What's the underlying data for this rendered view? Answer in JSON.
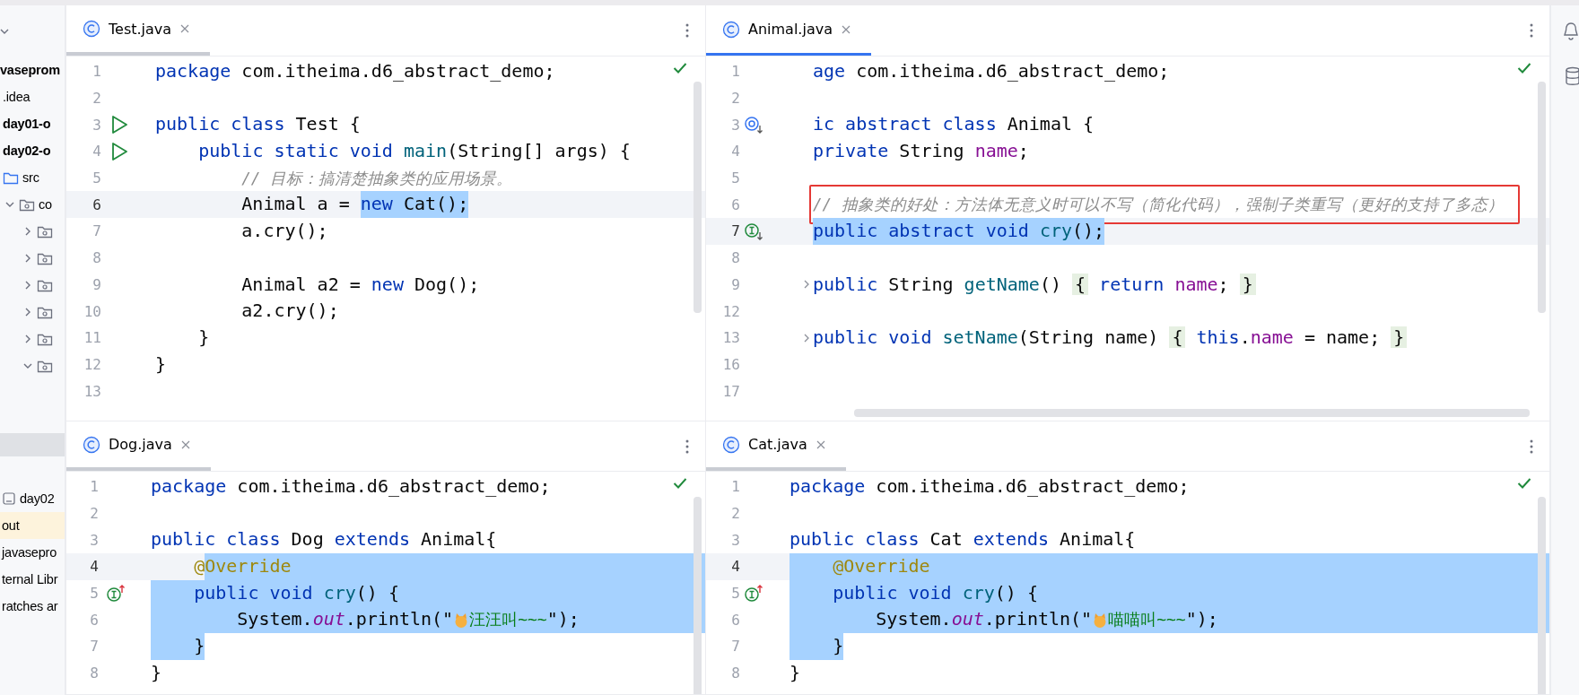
{
  "sidebar": {
    "tree": [
      {
        "label": "vaseprom",
        "bold": true,
        "children": [
          {
            "label": ".idea",
            "bold": false
          },
          {
            "label": "day01-o",
            "bold": true
          },
          {
            "label": "day02-o",
            "bold": true
          },
          {
            "label": "src",
            "bold": false,
            "kind": "folder",
            "children": [
              {
                "label": "co",
                "bold": false,
                "kind": "package",
                "expanded": true,
                "children": [
                  {
                    "kind": "package",
                    "expanded": false
                  },
                  {
                    "kind": "package",
                    "expanded": false
                  },
                  {
                    "kind": "package",
                    "expanded": false
                  },
                  {
                    "kind": "package",
                    "expanded": false
                  },
                  {
                    "kind": "package",
                    "expanded": false
                  },
                  {
                    "kind": "package",
                    "expanded": true
                  }
                ]
              }
            ]
          }
        ]
      }
    ],
    "lower": [
      {
        "label": "day02",
        "kind": "module",
        "highlighted": false
      },
      {
        "label": "out",
        "highlighted": true
      },
      {
        "label": "javasepro",
        "highlighted": false
      },
      {
        "label": "ternal Libr",
        "highlighted": false
      },
      {
        "label": "ratches ar",
        "highlighted": false
      }
    ]
  },
  "panes": [
    {
      "tabs": [
        {
          "label": "Test.java",
          "selected": false
        }
      ],
      "h_scroll": false,
      "lines": [
        {
          "num": "1",
          "current": false,
          "folded": false,
          "boxed": false,
          "eol_selected": false,
          "tokens": [
            {
              "t": "package",
              "kind": "kw",
              "selected": false
            },
            {
              "t": " com.itheima.d6_abstract_demo;",
              "kind": "pl",
              "selected": false
            }
          ]
        },
        {
          "num": "2",
          "current": false,
          "folded": false,
          "boxed": false,
          "eol_selected": false
        },
        {
          "num": "3",
          "gutter": {
            "kind": "run"
          },
          "current": false,
          "folded": false,
          "boxed": false,
          "eol_selected": false,
          "tokens": [
            {
              "t": "public class",
              "kind": "kw",
              "selected": false
            },
            {
              "t": " Test {",
              "kind": "pl",
              "selected": false
            }
          ]
        },
        {
          "num": "4",
          "gutter": {
            "kind": "run"
          },
          "current": false,
          "folded": false,
          "boxed": false,
          "eol_selected": false,
          "tokens": [
            {
              "t": "    public static void",
              "kind": "kw",
              "selected": false
            },
            {
              "t": " main",
              "kind": "fn",
              "selected": false
            },
            {
              "t": "(String[] args) {",
              "kind": "pl",
              "selected": false
            }
          ]
        },
        {
          "num": "5",
          "current": false,
          "folded": false,
          "boxed": false,
          "eol_selected": false,
          "tokens": [
            {
              "t": "        // 目标：搞清楚抽象类的应用场景。",
              "kind": "cm",
              "selected": false
            }
          ]
        },
        {
          "num": "6",
          "current": true,
          "folded": false,
          "boxed": false,
          "eol_selected": false,
          "tokens": [
            {
              "t": "        Animal a = ",
              "kind": "pl",
              "selected": false
            },
            {
              "t": "new",
              "kind": "kw",
              "selected": true
            },
            {
              "t": " Cat();",
              "kind": "pl",
              "selected": true
            }
          ]
        },
        {
          "num": "7",
          "current": false,
          "folded": false,
          "boxed": false,
          "eol_selected": false,
          "tokens": [
            {
              "t": "        a.cry();",
              "kind": "pl",
              "selected": false
            }
          ]
        },
        {
          "num": "8",
          "current": false,
          "folded": false,
          "boxed": false,
          "eol_selected": false
        },
        {
          "num": "9",
          "current": false,
          "folded": false,
          "boxed": false,
          "eol_selected": false,
          "tokens": [
            {
              "t": "        Animal a2 = ",
              "kind": "pl",
              "selected": false
            },
            {
              "t": "new",
              "kind": "kw",
              "selected": false
            },
            {
              "t": " Dog();",
              "kind": "pl",
              "selected": false
            }
          ]
        },
        {
          "num": "10",
          "current": false,
          "folded": false,
          "boxed": false,
          "eol_selected": false,
          "tokens": [
            {
              "t": "        a2.cry();",
              "kind": "pl",
              "selected": false
            }
          ]
        },
        {
          "num": "11",
          "current": false,
          "folded": false,
          "boxed": false,
          "eol_selected": false,
          "tokens": [
            {
              "t": "    }",
              "kind": "pl",
              "selected": false
            }
          ]
        },
        {
          "num": "12",
          "current": false,
          "folded": false,
          "boxed": false,
          "eol_selected": false,
          "tokens": [
            {
              "t": "}",
              "kind": "pl",
              "selected": false
            }
          ]
        },
        {
          "num": "13",
          "current": false,
          "folded": false,
          "boxed": false,
          "eol_selected": false
        }
      ]
    },
    {
      "tabs": [
        {
          "label": "Animal.java",
          "selected": true
        }
      ],
      "h_scroll": true,
      "lines": [
        {
          "num": "1",
          "current": false,
          "folded": false,
          "boxed": false,
          "eol_selected": false,
          "tokens": [
            {
              "t": "age",
              "kind": "kw",
              "selected": false
            },
            {
              "t": " com.itheima.d6_abstract_demo;",
              "kind": "pl",
              "selected": false
            }
          ]
        },
        {
          "num": "2",
          "current": false,
          "folded": false,
          "boxed": false,
          "eol_selected": false
        },
        {
          "num": "3",
          "gutter": {
            "kind": "subclassed"
          },
          "current": false,
          "folded": false,
          "boxed": false,
          "eol_selected": false,
          "tokens": [
            {
              "t": "ic abstract class",
              "kind": "kw",
              "selected": false
            },
            {
              "t": " Animal {",
              "kind": "pl",
              "selected": false
            }
          ]
        },
        {
          "num": "4",
          "current": false,
          "folded": false,
          "boxed": false,
          "eol_selected": false,
          "tokens": [
            {
              "t": "private",
              "kind": "kw",
              "selected": false
            },
            {
              "t": " String ",
              "kind": "pl",
              "selected": false
            },
            {
              "t": "name",
              "kind": "fd",
              "selected": false
            },
            {
              "t": ";",
              "kind": "pl",
              "selected": false
            }
          ]
        },
        {
          "num": "5",
          "current": false,
          "folded": false,
          "boxed": false,
          "eol_selected": false
        },
        {
          "num": "6",
          "current": false,
          "folded": false,
          "boxed": true,
          "eol_selected": false,
          "tokens": [
            {
              "t": "// 抽象类的好处：方法体无意义时可以不写（简化代码），强制子类重写（更好的支持了多态）",
              "kind": "cm",
              "selected": false
            }
          ]
        },
        {
          "num": "7",
          "gutter": {
            "kind": "implemented"
          },
          "current": true,
          "folded": false,
          "boxed": false,
          "eol_selected": false,
          "tokens": [
            {
              "t": "public abstract void",
              "kind": "kw",
              "selected": true
            },
            {
              "t": " cry",
              "kind": "fn",
              "selected": true
            },
            {
              "t": "();",
              "kind": "pl",
              "selected": true
            }
          ]
        },
        {
          "num": "8",
          "current": false,
          "folded": false,
          "boxed": false,
          "eol_selected": false
        },
        {
          "num": "9",
          "current": false,
          "folded": true,
          "boxed": false,
          "eol_selected": false,
          "tokens": [
            {
              "t": "public",
              "kind": "kw",
              "selected": false
            },
            {
              "t": " String ",
              "kind": "pl",
              "selected": false
            },
            {
              "t": "getName",
              "kind": "fn",
              "selected": false
            },
            {
              "t": "() ",
              "kind": "pl",
              "selected": false
            },
            {
              "t": "{",
              "kind": "fold",
              "selected": false
            },
            {
              "t": " return",
              "kind": "kw",
              "selected": false
            },
            {
              "t": " name",
              "kind": "fd",
              "selected": false
            },
            {
              "t": "; ",
              "kind": "pl",
              "selected": false
            },
            {
              "t": "}",
              "kind": "fold",
              "selected": false
            }
          ]
        },
        {
          "num": "12",
          "current": false,
          "folded": false,
          "boxed": false,
          "eol_selected": false
        },
        {
          "num": "13",
          "current": false,
          "folded": true,
          "boxed": false,
          "eol_selected": false,
          "tokens": [
            {
              "t": "public void",
              "kind": "kw",
              "selected": false
            },
            {
              "t": " setName",
              "kind": "fn",
              "selected": false
            },
            {
              "t": "(String name) ",
              "kind": "pl",
              "selected": false
            },
            {
              "t": "{",
              "kind": "fold",
              "selected": false
            },
            {
              "t": " this",
              "kind": "kw",
              "selected": false
            },
            {
              "t": ".",
              "kind": "pl",
              "selected": false
            },
            {
              "t": "name",
              "kind": "fd",
              "selected": false
            },
            {
              "t": " = name; ",
              "kind": "pl",
              "selected": false
            },
            {
              "t": "}",
              "kind": "fold",
              "selected": false
            }
          ]
        },
        {
          "num": "16",
          "current": false,
          "folded": false,
          "boxed": false,
          "eol_selected": false
        },
        {
          "num": "17",
          "current": false,
          "folded": false,
          "boxed": false,
          "eol_selected": false
        }
      ]
    },
    {
      "tabs": [
        {
          "label": "Dog.java",
          "selected": false
        }
      ],
      "h_scroll": false,
      "lines": [
        {
          "num": "1",
          "current": false,
          "folded": false,
          "boxed": false,
          "eol_selected": false,
          "tokens": [
            {
              "t": "package",
              "kind": "kw",
              "selected": false
            },
            {
              "t": " com.itheima.d6_abstract_demo;",
              "kind": "pl",
              "selected": false
            }
          ]
        },
        {
          "num": "2",
          "current": false,
          "folded": false,
          "boxed": false,
          "eol_selected": false
        },
        {
          "num": "3",
          "current": false,
          "folded": false,
          "boxed": false,
          "eol_selected": false,
          "tokens": [
            {
              "t": "public class",
              "kind": "kw",
              "selected": false
            },
            {
              "t": " Dog ",
              "kind": "pl",
              "selected": false
            },
            {
              "t": "extends",
              "kind": "kw",
              "selected": false
            },
            {
              "t": " Animal{",
              "kind": "pl",
              "selected": false
            }
          ]
        },
        {
          "num": "4",
          "current": true,
          "folded": false,
          "boxed": false,
          "eol_selected": true,
          "tokens": [
            {
              "t": "    @",
              "kind": "an",
              "selected": false
            },
            {
              "t": "Override",
              "kind": "an",
              "selected": true
            }
          ]
        },
        {
          "num": "5",
          "gutter": {
            "kind": "implements"
          },
          "current": false,
          "folded": false,
          "boxed": false,
          "eol_selected": true,
          "tokens": [
            {
              "t": "    public void",
              "kind": "kw",
              "selected": true
            },
            {
              "t": " cry",
              "kind": "fn",
              "selected": true
            },
            {
              "t": "() {",
              "kind": "pl",
              "selected": true
            }
          ]
        },
        {
          "num": "6",
          "current": false,
          "folded": false,
          "boxed": false,
          "eol_selected": true,
          "tokens": [
            {
              "t": "        System.",
              "kind": "pl",
              "selected": true
            },
            {
              "t": "out",
              "kind": "sf",
              "selected": true
            },
            {
              "t": ".println(\"",
              "kind": "pl",
              "selected": true
            },
            {
              "kind": "icon",
              "selected": true
            },
            {
              "t": "汪汪叫~~~",
              "kind": "st",
              "selected": true
            },
            {
              "t": "\");",
              "kind": "pl",
              "selected": true
            }
          ]
        },
        {
          "num": "7",
          "current": false,
          "folded": false,
          "boxed": false,
          "eol_selected": false,
          "tokens": [
            {
              "t": "    }",
              "kind": "pl",
              "selected": true
            }
          ]
        },
        {
          "num": "8",
          "current": false,
          "folded": false,
          "boxed": false,
          "eol_selected": false,
          "tokens": [
            {
              "t": "}",
              "kind": "pl",
              "selected": false
            }
          ]
        }
      ]
    },
    {
      "tabs": [
        {
          "label": "Cat.java",
          "selected": false
        }
      ],
      "h_scroll": false,
      "lines": [
        {
          "num": "1",
          "current": false,
          "folded": false,
          "boxed": false,
          "eol_selected": false,
          "tokens": [
            {
              "t": "package",
              "kind": "kw",
              "selected": false
            },
            {
              "t": " com.itheima.d6_abstract_demo;",
              "kind": "pl",
              "selected": false
            }
          ]
        },
        {
          "num": "2",
          "current": false,
          "folded": false,
          "boxed": false,
          "eol_selected": false
        },
        {
          "num": "3",
          "current": false,
          "folded": false,
          "boxed": false,
          "eol_selected": false,
          "tokens": [
            {
              "t": "public class",
              "kind": "kw",
              "selected": false
            },
            {
              "t": " Cat ",
              "kind": "pl",
              "selected": false
            },
            {
              "t": "extends",
              "kind": "kw",
              "selected": false
            },
            {
              "t": " Animal{",
              "kind": "pl",
              "selected": false
            }
          ]
        },
        {
          "num": "4",
          "current": true,
          "folded": false,
          "boxed": false,
          "eol_selected": true,
          "tokens": [
            {
              "t": "    @Override",
              "kind": "an",
              "selected": true
            }
          ]
        },
        {
          "num": "5",
          "gutter": {
            "kind": "implements"
          },
          "current": false,
          "folded": false,
          "boxed": false,
          "eol_selected": true,
          "tokens": [
            {
              "t": "    public void",
              "kind": "kw",
              "selected": true
            },
            {
              "t": " cry",
              "kind": "fn",
              "selected": true
            },
            {
              "t": "() {",
              "kind": "pl",
              "selected": true
            }
          ]
        },
        {
          "num": "6",
          "current": false,
          "folded": false,
          "boxed": false,
          "eol_selected": true,
          "tokens": [
            {
              "t": "        System.",
              "kind": "pl",
              "selected": true
            },
            {
              "t": "out",
              "kind": "sf",
              "selected": true
            },
            {
              "t": ".println(\"",
              "kind": "pl",
              "selected": true
            },
            {
              "kind": "icon",
              "selected": true
            },
            {
              "t": "喵喵叫~~~",
              "kind": "st",
              "selected": true
            },
            {
              "t": "\");",
              "kind": "pl",
              "selected": true
            }
          ]
        },
        {
          "num": "7",
          "current": false,
          "folded": false,
          "boxed": false,
          "eol_selected": false,
          "tokens": [
            {
              "t": "    }",
              "kind": "pl",
              "selected": true
            }
          ]
        },
        {
          "num": "8",
          "current": false,
          "folded": false,
          "boxed": false,
          "eol_selected": false,
          "tokens": [
            {
              "t": "}",
              "kind": "pl",
              "selected": false
            }
          ]
        }
      ]
    }
  ]
}
